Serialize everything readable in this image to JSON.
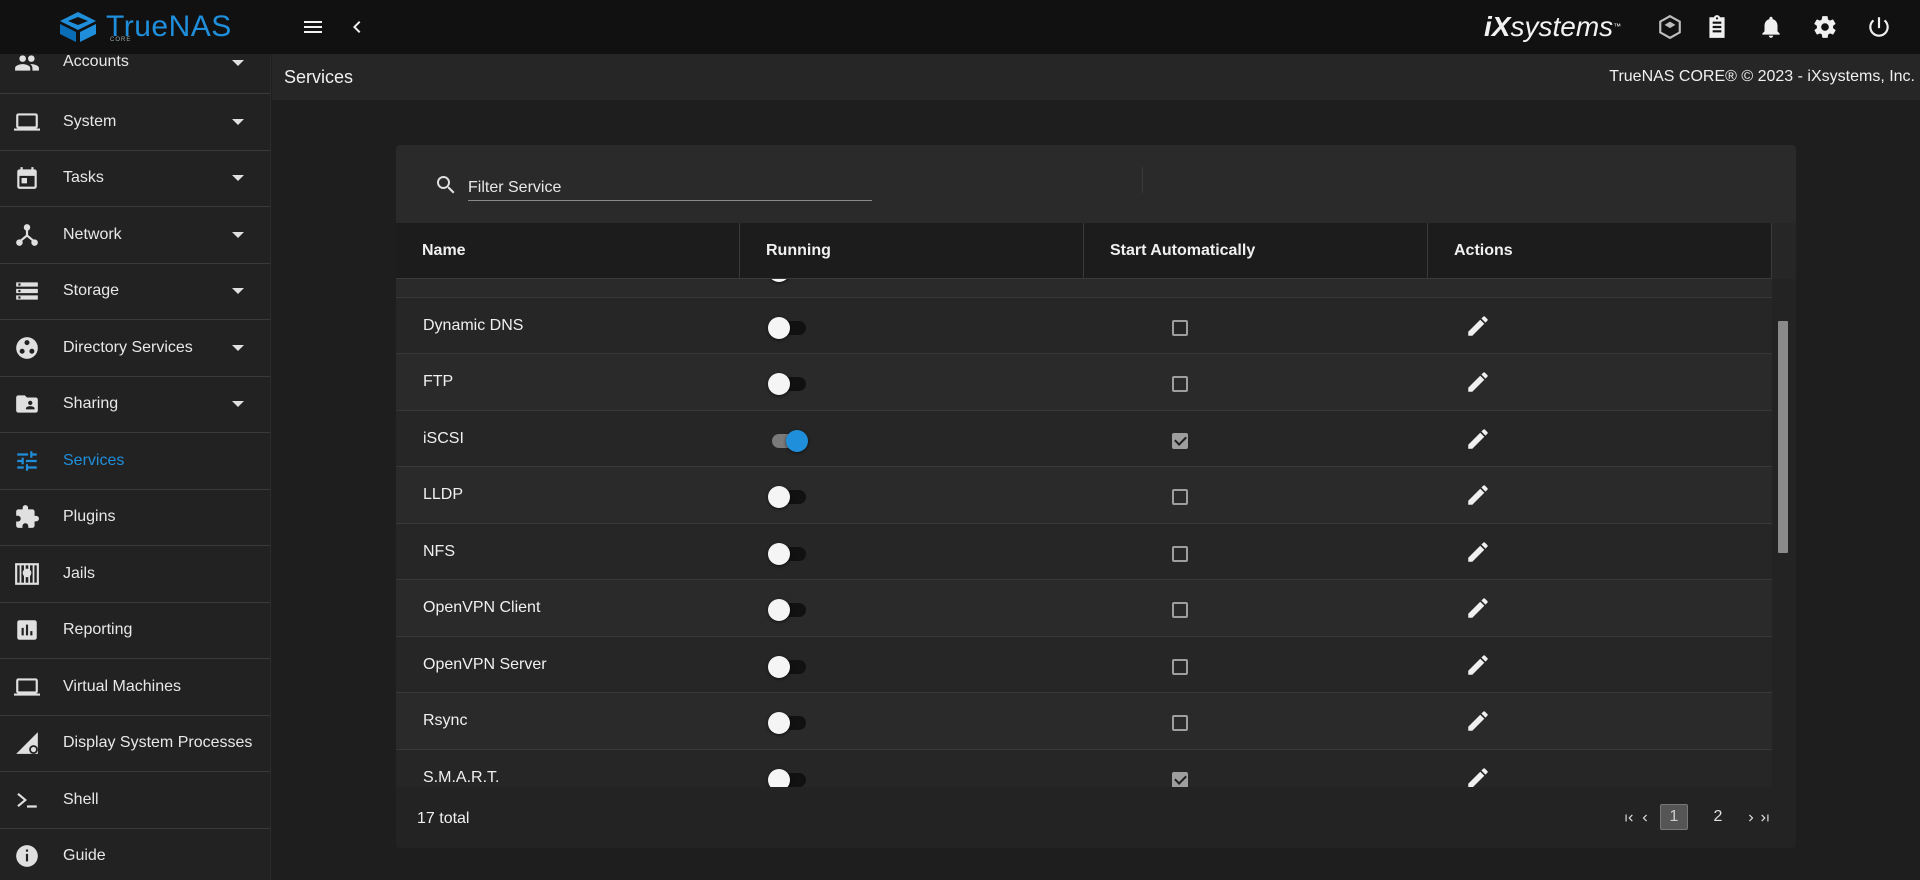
{
  "topbar": {
    "brand": "TrueNAS",
    "brand_sub": "CORE",
    "ix_brand_prefix": "iX",
    "ix_brand_suffix": "systems"
  },
  "sidebar": {
    "items": [
      {
        "label": "Accounts",
        "icon": "accounts-icon",
        "expandable": true
      },
      {
        "label": "System",
        "icon": "laptop-icon",
        "expandable": true
      },
      {
        "label": "Tasks",
        "icon": "calendar-icon",
        "expandable": true
      },
      {
        "label": "Network",
        "icon": "network-icon",
        "expandable": true
      },
      {
        "label": "Storage",
        "icon": "storage-icon",
        "expandable": true
      },
      {
        "label": "Directory Services",
        "icon": "directory-icon",
        "expandable": true
      },
      {
        "label": "Sharing",
        "icon": "folder-share-icon",
        "expandable": true
      },
      {
        "label": "Services",
        "icon": "tune-icon",
        "expandable": false,
        "active": true
      },
      {
        "label": "Plugins",
        "icon": "puzzle-icon",
        "expandable": false
      },
      {
        "label": "Jails",
        "icon": "jail-icon",
        "expandable": false
      },
      {
        "label": "Reporting",
        "icon": "chart-icon",
        "expandable": false
      },
      {
        "label": "Virtual Machines",
        "icon": "laptop-icon",
        "expandable": false
      },
      {
        "label": "Display System Processes",
        "icon": "processes-icon",
        "expandable": false
      },
      {
        "label": "Shell",
        "icon": "console-icon",
        "expandable": false
      },
      {
        "label": "Guide",
        "icon": "info-icon",
        "expandable": false
      }
    ]
  },
  "page": {
    "title": "Services",
    "copyright": "TrueNAS CORE® © 2023 - iXsystems, Inc."
  },
  "filter": {
    "placeholder": "Filter Service"
  },
  "table": {
    "columns": [
      "Name",
      "Running",
      "Start Automatically",
      "Actions"
    ],
    "rows": [
      {
        "name": "",
        "running": false,
        "auto": false
      },
      {
        "name": "Dynamic DNS",
        "running": false,
        "auto": false
      },
      {
        "name": "FTP",
        "running": false,
        "auto": false
      },
      {
        "name": "iSCSI",
        "running": true,
        "auto": true
      },
      {
        "name": "LLDP",
        "running": false,
        "auto": false
      },
      {
        "name": "NFS",
        "running": false,
        "auto": false
      },
      {
        "name": "OpenVPN Client",
        "running": false,
        "auto": false
      },
      {
        "name": "OpenVPN Server",
        "running": false,
        "auto": false
      },
      {
        "name": "Rsync",
        "running": false,
        "auto": false
      },
      {
        "name": "S.M.A.R.T.",
        "running": false,
        "auto": true
      }
    ]
  },
  "footer": {
    "total": "17 total",
    "pages": [
      "1",
      "2"
    ],
    "current_page": "1"
  },
  "colors": {
    "accent": "#1f8fdc",
    "background": "#1e1e1e",
    "topbar": "#111111"
  }
}
